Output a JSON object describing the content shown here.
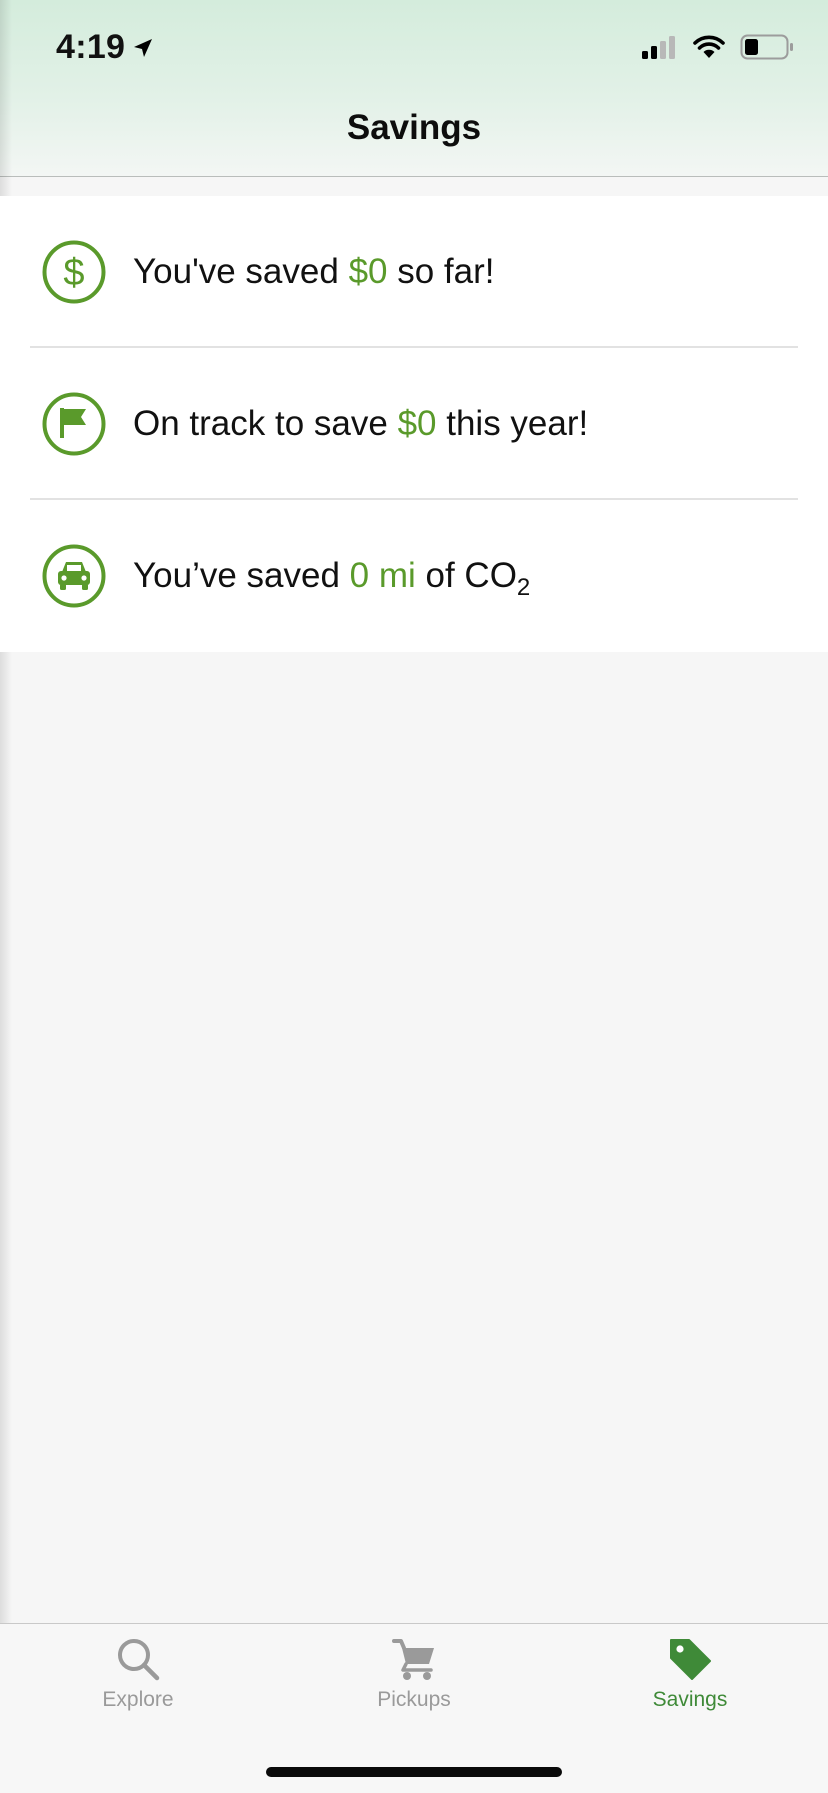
{
  "status_bar": {
    "time": "4:19",
    "icons": [
      "location-arrow-icon",
      "cellular-signal-icon",
      "wifi-icon",
      "battery-icon"
    ]
  },
  "nav": {
    "title": "Savings"
  },
  "savings_rows": [
    {
      "icon": "dollar-circle-icon",
      "before": "You've saved ",
      "value": "$0",
      "after": " so far!"
    },
    {
      "icon": "flag-circle-icon",
      "before": "On track to save ",
      "value": "$0",
      "after": " this year!"
    },
    {
      "icon": "car-circle-icon",
      "before": "You’ve saved ",
      "value": "0 mi",
      "after": " of CO",
      "subscript": "2"
    }
  ],
  "tabs": [
    {
      "label": "Explore",
      "icon": "search-icon",
      "active": false
    },
    {
      "label": "Pickups",
      "icon": "cart-icon",
      "active": false
    },
    {
      "label": "Savings",
      "icon": "tag-icon",
      "active": true
    }
  ],
  "colors": {
    "accent_green": "#5a9a2b",
    "tab_active_green": "#3f8a38",
    "tab_inactive_gray": "#9a9a9a",
    "header_gradient_top": "#d4ecdc"
  }
}
